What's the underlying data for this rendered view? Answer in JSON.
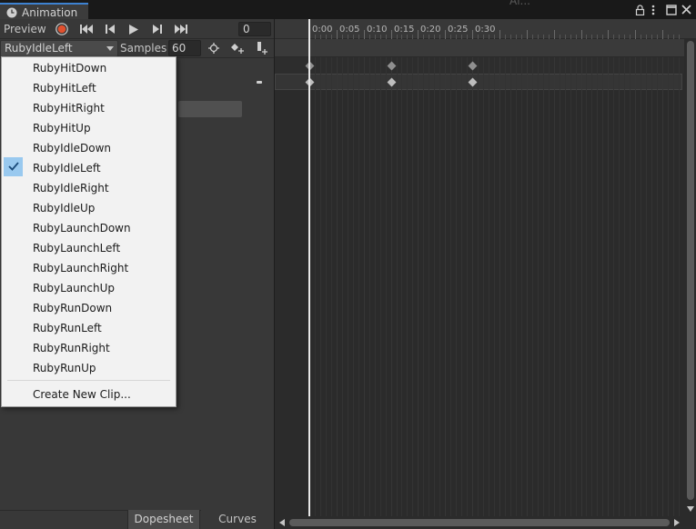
{
  "window": {
    "tab_title": "Animation",
    "background_text": "Al...",
    "icons": [
      "clock-icon",
      "lock-icon",
      "kebab-menu-icon",
      "maximize-icon",
      "close-icon"
    ]
  },
  "toolbar": {
    "preview_label": "Preview",
    "current_frame": "0",
    "buttons": [
      "record-button",
      "first-keyframe-button",
      "previous-keyframe-button",
      "play-button",
      "next-keyframe-button",
      "last-keyframe-button"
    ],
    "record_color": "#e0502e"
  },
  "clip_bar": {
    "selected_clip": "RubyIdleLeft",
    "samples_label": "Samples",
    "samples_value": "60"
  },
  "clip_menu": {
    "items": [
      "RubyHitDown",
      "RubyHitLeft",
      "RubyHitRight",
      "RubyHitUp",
      "RubyIdleDown",
      "RubyIdleLeft",
      "RubyIdleRight",
      "RubyIdleUp",
      "RubyLaunchDown",
      "RubyLaunchLeft",
      "RubyLaunchRight",
      "RubyLaunchUp",
      "RubyRunDown",
      "RubyRunLeft",
      "RubyRunRight",
      "RubyRunUp"
    ],
    "checked_item": "RubyIdleLeft",
    "create_label": "Create New Clip..."
  },
  "timeline": {
    "ruler_labels": [
      "0:00",
      "0:05",
      "0:10",
      "0:15",
      "0:20",
      "0:25",
      "0:30"
    ],
    "playhead_frame": 0,
    "keyframes": [
      0,
      15,
      30
    ]
  },
  "bottom_tabs": {
    "dopesheet": "Dopesheet",
    "curves": "Curves"
  }
}
